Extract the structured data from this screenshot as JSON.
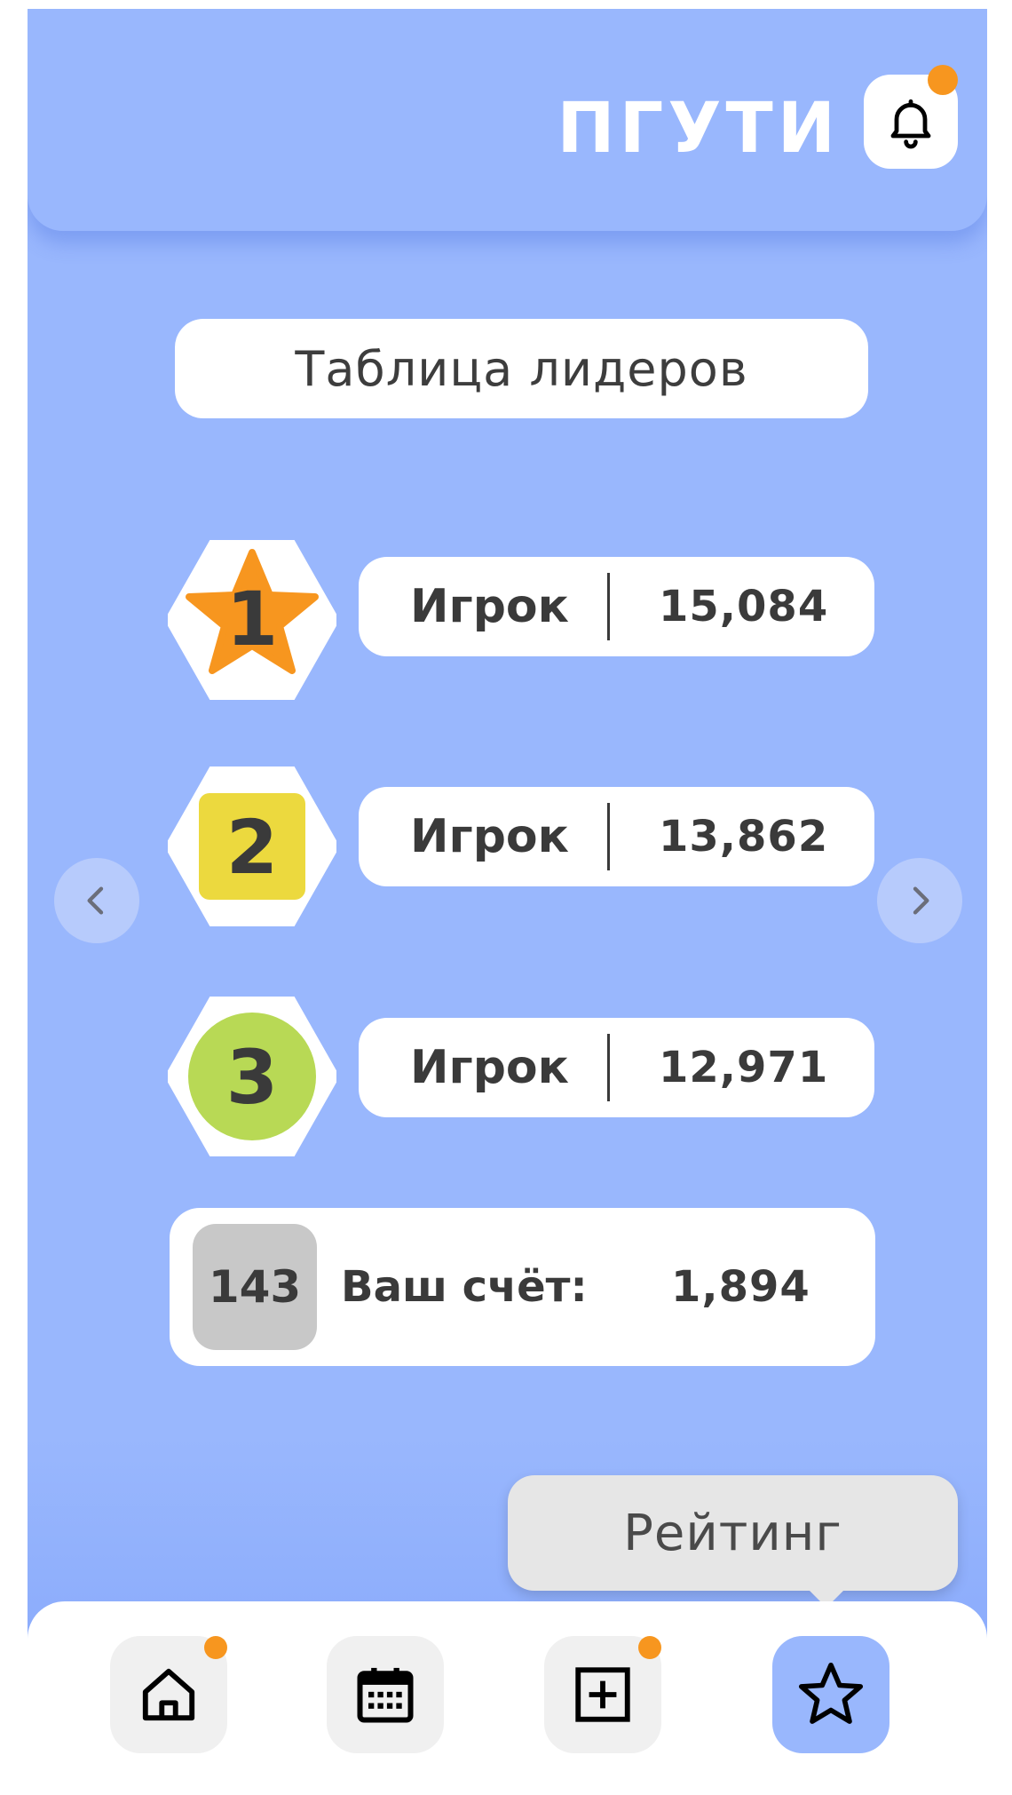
{
  "header": {
    "brand": "ПГУТИ",
    "notification_icon": "bell-icon",
    "has_notification": true
  },
  "colors": {
    "primary_bg": "#99b7fd",
    "accent_dot": "#f7961f",
    "gold": "#f7961f",
    "silver_yellow": "#ecd93e",
    "bronze_green": "#b8d955",
    "rank_gray": "#c8c8c8",
    "text_dark": "#3a3a3a"
  },
  "main": {
    "title": "Таблица лидеров",
    "leaders": [
      {
        "rank": "1",
        "name": "Игрок",
        "score": "15,084",
        "badge": "star"
      },
      {
        "rank": "2",
        "name": "Игрок",
        "score": "13,862",
        "badge": "square"
      },
      {
        "rank": "3",
        "name": "Игрок",
        "score": "12,971",
        "badge": "circle"
      }
    ],
    "your_result": {
      "rank": "143",
      "label": "Ваш счёт:",
      "score": "1,894"
    },
    "prev_icon": "chevron-left-icon",
    "next_icon": "chevron-right-icon"
  },
  "tooltip": {
    "text": "Рейтинг"
  },
  "navbar": {
    "items": [
      {
        "icon": "home-icon",
        "has_notification": true,
        "active": false
      },
      {
        "icon": "calendar-icon",
        "has_notification": false,
        "active": false
      },
      {
        "icon": "plus-square-icon",
        "has_notification": true,
        "active": false
      },
      {
        "icon": "star-icon",
        "has_notification": false,
        "active": true
      }
    ]
  }
}
